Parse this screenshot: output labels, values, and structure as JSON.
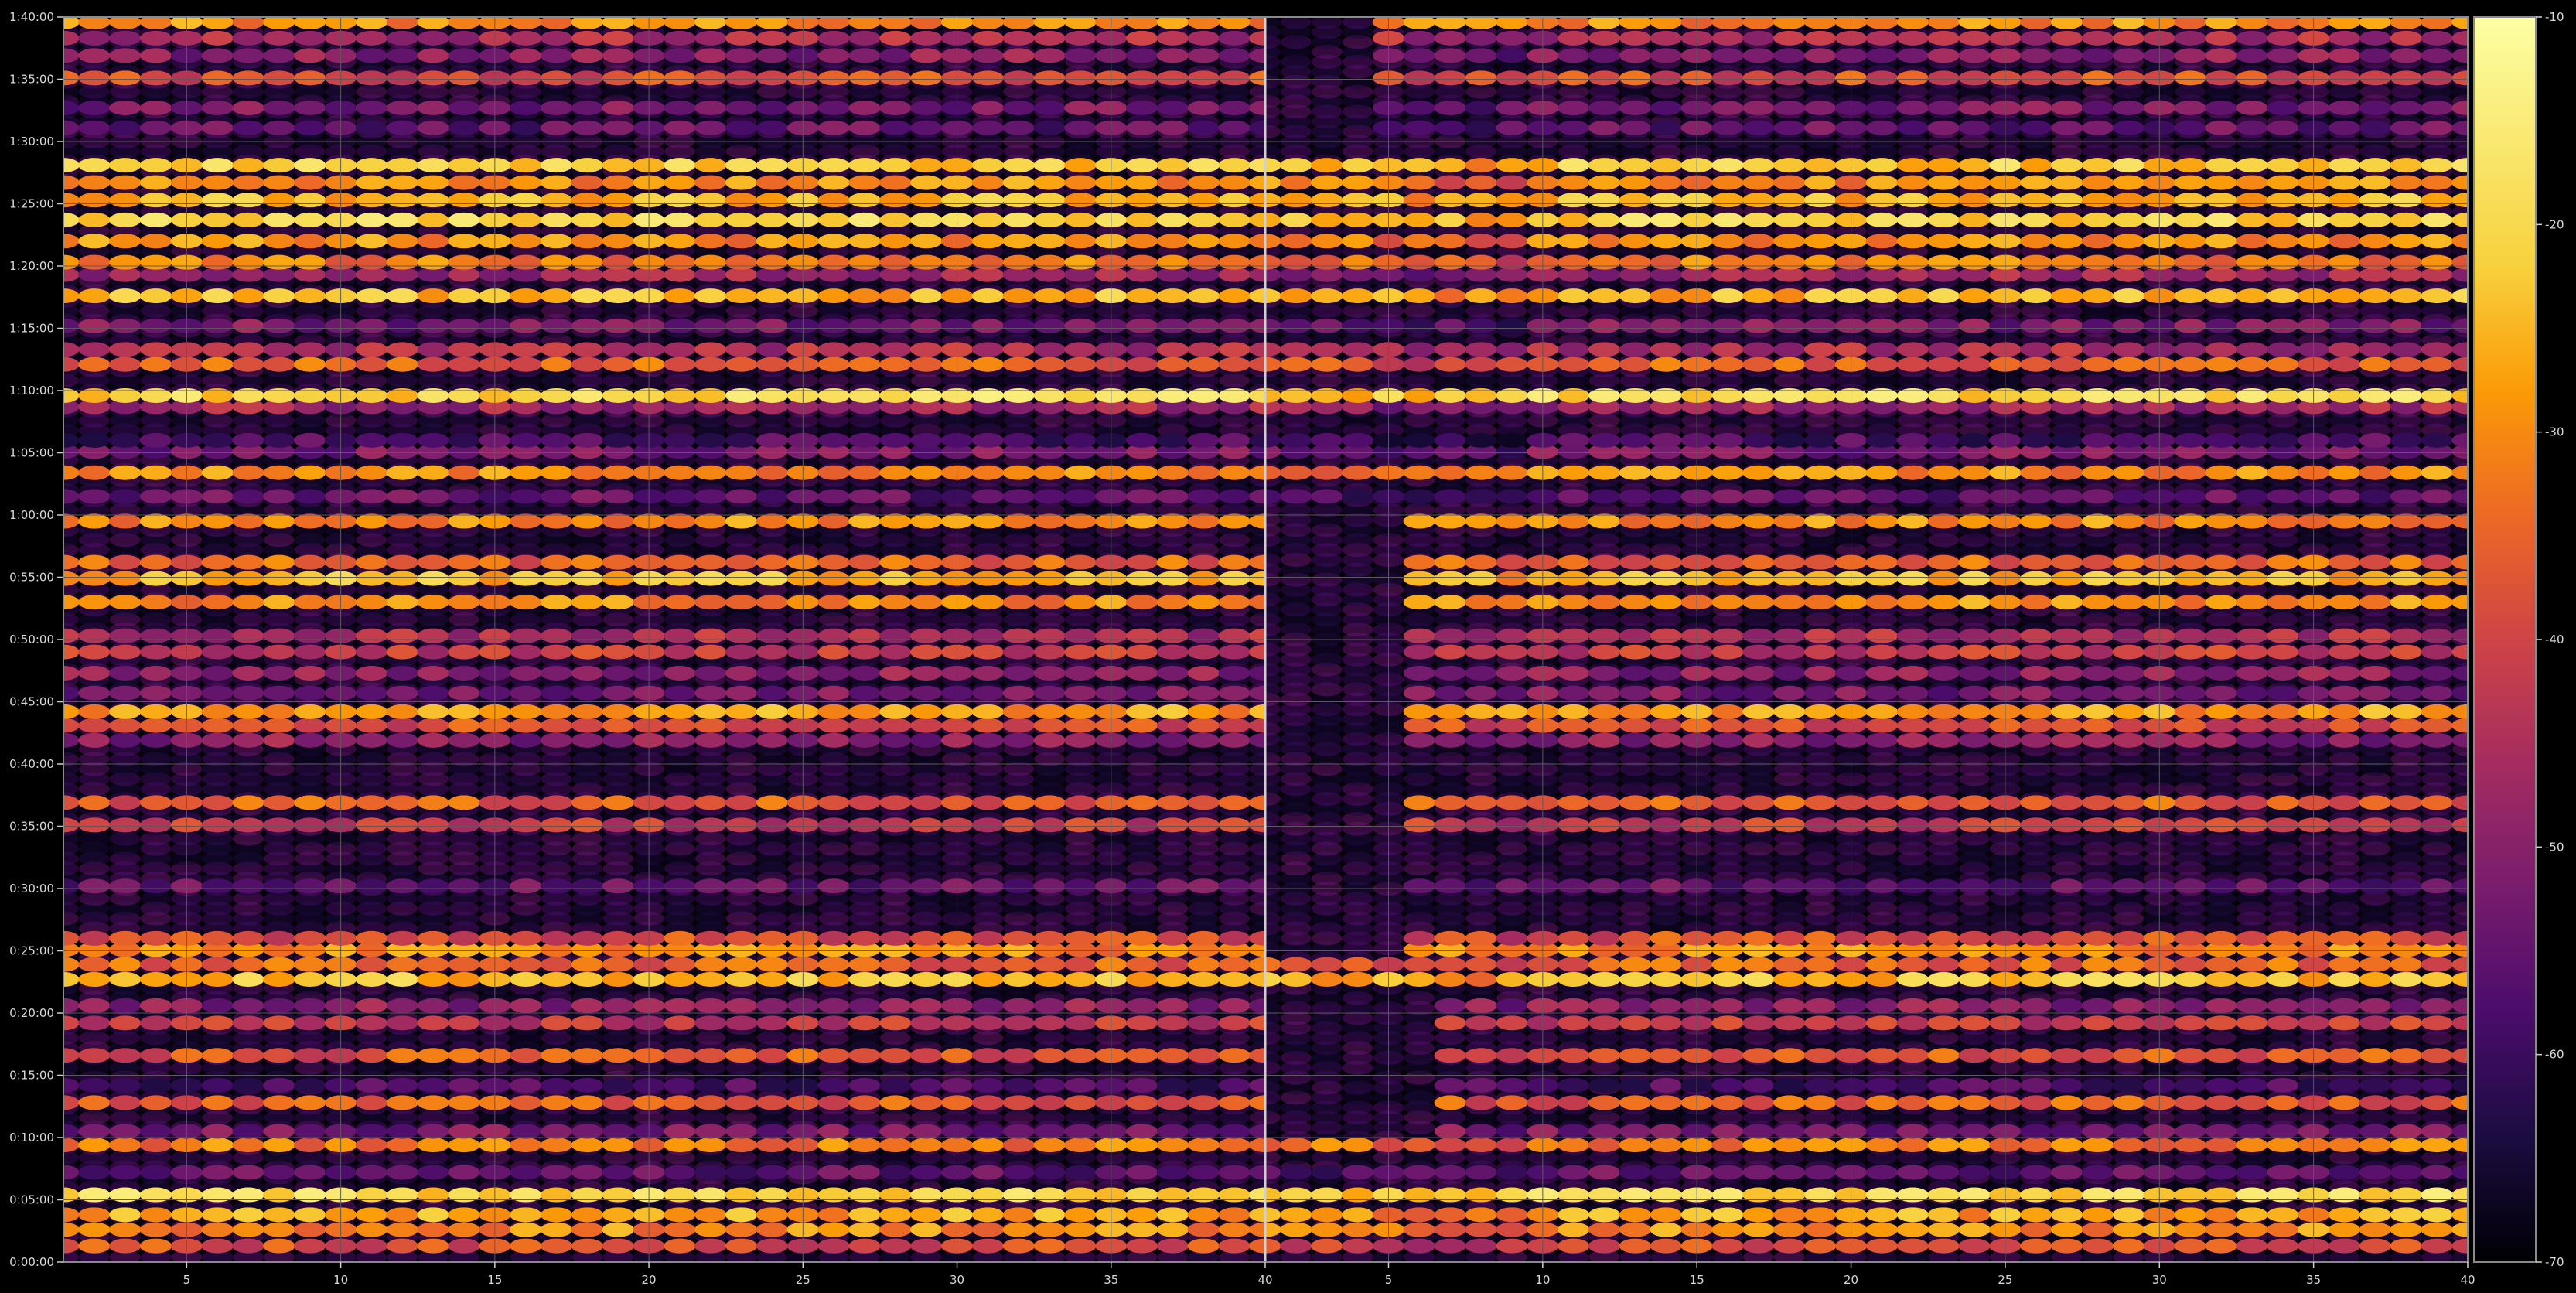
{
  "chart_data": {
    "type": "heatmap",
    "title": "",
    "xlabel": "",
    "ylabel": "",
    "background": "#000000",
    "grid": true,
    "grid_color": "#5a5a5a",
    "colormap": "inferno",
    "panels": [
      {
        "name": "",
        "x_range": [
          1,
          40
        ],
        "x_ticks": [
          5,
          10,
          15,
          20,
          25,
          30,
          35,
          40
        ],
        "x_tick_labels": [
          "5",
          "10",
          "15",
          "20",
          "25",
          "30",
          "35",
          "40"
        ]
      },
      {
        "name": "",
        "x_range": [
          1,
          40
        ],
        "x_ticks": [
          5,
          10,
          15,
          20,
          25,
          30,
          35,
          40
        ],
        "x_tick_labels": [
          "5",
          "10",
          "15",
          "20",
          "25",
          "30",
          "35",
          "40"
        ]
      }
    ],
    "y_range_minutes": [
      0,
      100
    ],
    "y_ticks": [
      0,
      5,
      10,
      15,
      20,
      25,
      30,
      35,
      40,
      45,
      50,
      55,
      60,
      65,
      70,
      75,
      80,
      85,
      90,
      95,
      100
    ],
    "y_tick_labels": [
      "0:00:00",
      "0:05:00",
      "0:10:00",
      "0:15:00",
      "0:20:00",
      "0:25:00",
      "0:30:00",
      "0:35:00",
      "0:40:00",
      "0:45:00",
      "0:50:00",
      "0:55:00",
      "1:00:00",
      "1:05:00",
      "1:10:00",
      "1:15:00",
      "1:20:00",
      "1:25:00",
      "1:30:00",
      "1:35:00",
      "1:40:00"
    ],
    "colorbar": {
      "range": [
        -70,
        -10
      ],
      "ticks": [
        -10,
        -20,
        -30,
        -40,
        -50,
        -60,
        -70
      ],
      "tick_labels": [
        "-10",
        "-20",
        "-30",
        "-40",
        "-50",
        "-60",
        "-70"
      ]
    },
    "bands": [
      {
        "t": 1.3,
        "v": -38
      },
      {
        "t": 2.6,
        "v": -30
      },
      {
        "t": 3.8,
        "v": -27
      },
      {
        "t": 5.4,
        "v": -20
      },
      {
        "t": 7.2,
        "v": -55
      },
      {
        "t": 9.4,
        "v": -32
      },
      {
        "t": 10.5,
        "v": -52
      },
      {
        "t": 12.8,
        "v": -36
      },
      {
        "t": 14.2,
        "v": -58
      },
      {
        "t": 16.6,
        "v": -37
      },
      {
        "t": 19.2,
        "v": -42
      },
      {
        "t": 20.6,
        "v": -50
      },
      {
        "t": 22.7,
        "v": -24
      },
      {
        "t": 23.9,
        "v": -35
      },
      {
        "t": 25.1,
        "v": -30
      },
      {
        "t": 26.0,
        "v": -38
      },
      {
        "t": 30.2,
        "v": -55
      },
      {
        "t": 35.1,
        "v": -42
      },
      {
        "t": 36.9,
        "v": -36
      },
      {
        "t": 41.9,
        "v": -50
      },
      {
        "t": 43.1,
        "v": -38
      },
      {
        "t": 44.2,
        "v": -28
      },
      {
        "t": 45.7,
        "v": -52
      },
      {
        "t": 47.3,
        "v": -50
      },
      {
        "t": 49.0,
        "v": -42
      },
      {
        "t": 50.3,
        "v": -45
      },
      {
        "t": 53.0,
        "v": -30
      },
      {
        "t": 54.9,
        "v": -25
      },
      {
        "t": 56.2,
        "v": -35
      },
      {
        "t": 59.5,
        "v": -30
      },
      {
        "t": 61.5,
        "v": -55
      },
      {
        "t": 63.4,
        "v": -30
      },
      {
        "t": 65.1,
        "v": -52
      },
      {
        "t": 66.0,
        "v": -58
      },
      {
        "t": 68.7,
        "v": -47
      },
      {
        "t": 69.6,
        "v": -20
      },
      {
        "t": 72.1,
        "v": -35
      },
      {
        "t": 73.3,
        "v": -45
      },
      {
        "t": 75.2,
        "v": -52
      },
      {
        "t": 77.6,
        "v": -25
      },
      {
        "t": 79.3,
        "v": -47
      },
      {
        "t": 80.3,
        "v": -32
      },
      {
        "t": 82.0,
        "v": -30
      },
      {
        "t": 83.7,
        "v": -21
      },
      {
        "t": 85.3,
        "v": -25
      },
      {
        "t": 86.7,
        "v": -30
      },
      {
        "t": 88.1,
        "v": -22
      },
      {
        "t": 91.1,
        "v": -55
      },
      {
        "t": 92.7,
        "v": -52
      },
      {
        "t": 95.1,
        "v": -38
      },
      {
        "t": 96.9,
        "v": -50
      },
      {
        "t": 98.3,
        "v": -45
      },
      {
        "t": 99.6,
        "v": -30
      }
    ],
    "panel2_start_column": [
      {
        "t_from": 0,
        "t_to": 10,
        "x": 1
      },
      {
        "t_from": 10,
        "t_to": 22,
        "x": 7
      },
      {
        "t_from": 22,
        "t_to": 24,
        "x": 1
      },
      {
        "t_from": 24,
        "t_to": 40,
        "x": 6
      },
      {
        "t_from": 40,
        "t_to": 60,
        "x": 6
      },
      {
        "t_from": 60,
        "t_to": 70,
        "x": 1
      },
      {
        "t_from": 70,
        "t_to": 90,
        "x": 1
      },
      {
        "t_from": 90,
        "t_to": 100,
        "x": 5
      }
    ]
  }
}
